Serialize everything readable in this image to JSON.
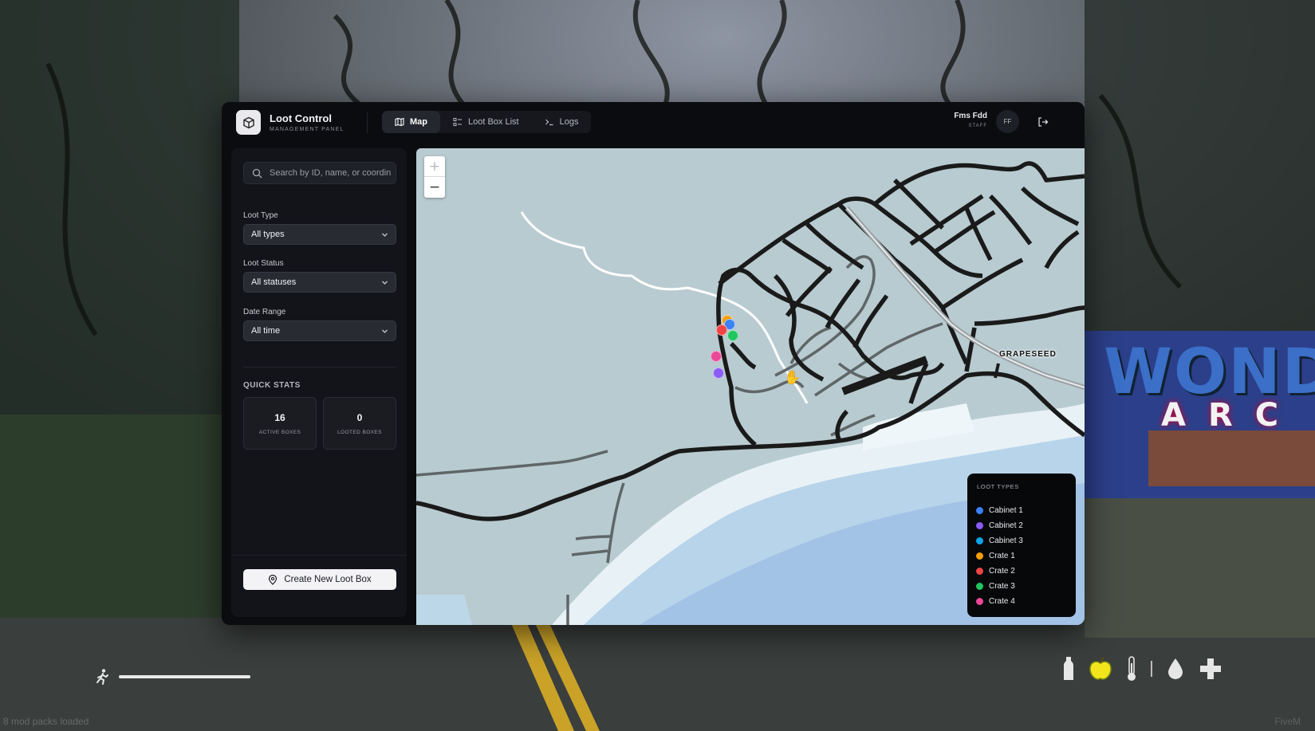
{
  "app": {
    "title": "Loot Control",
    "subtitle": "MANAGEMENT PANEL"
  },
  "tabs": [
    {
      "label": "Map",
      "icon": "map-icon",
      "active": true
    },
    {
      "label": "Loot Box List",
      "icon": "list-icon",
      "active": false
    },
    {
      "label": "Logs",
      "icon": "terminal-icon",
      "active": false
    }
  ],
  "user": {
    "name": "Fms Fdd",
    "role": "STAFF",
    "initials": "FF"
  },
  "search": {
    "placeholder": "Search by ID, name, or coordinates"
  },
  "filters": {
    "loot_type": {
      "label": "Loot Type",
      "value": "All types"
    },
    "loot_status": {
      "label": "Loot Status",
      "value": "All statuses"
    },
    "date_range": {
      "label": "Date Range",
      "value": "All time"
    }
  },
  "quick_stats": {
    "title": "QUICK STATS",
    "active": {
      "value": "16",
      "label": "ACTIVE BOXES"
    },
    "looted": {
      "value": "0",
      "label": "LOOTED BOXES"
    }
  },
  "create_button": "Create New Loot Box",
  "map": {
    "zoom_in": "+",
    "zoom_out": "−",
    "place_label": "GRAPESEED",
    "markers": [
      {
        "type": "Crate 1",
        "color": "#f59e0b"
      },
      {
        "type": "Cabinet 1",
        "color": "#3b82f6"
      },
      {
        "type": "Crate 2",
        "color": "#ef4444"
      },
      {
        "type": "Crate 3",
        "color": "#22c55e"
      },
      {
        "type": "Crate 4",
        "color": "#ec4899"
      },
      {
        "type": "Cabinet 2",
        "color": "#8b5cf6"
      }
    ]
  },
  "legend": {
    "title": "LOOT TYPES",
    "items": [
      {
        "label": "Cabinet 1",
        "color": "#3b82f6"
      },
      {
        "label": "Cabinet 2",
        "color": "#8b5cf6"
      },
      {
        "label": "Cabinet 3",
        "color": "#0ea5e9"
      },
      {
        "label": "Crate 1",
        "color": "#f59e0b"
      },
      {
        "label": "Crate 2",
        "color": "#ef4444"
      },
      {
        "label": "Crate 3",
        "color": "#22c55e"
      },
      {
        "label": "Crate 4",
        "color": "#ec4899"
      }
    ]
  },
  "background": {
    "sign_text": "WOND",
    "sign_subtext": "ARC",
    "status_left": "8 mod packs loaded",
    "status_right": "FiveM"
  }
}
